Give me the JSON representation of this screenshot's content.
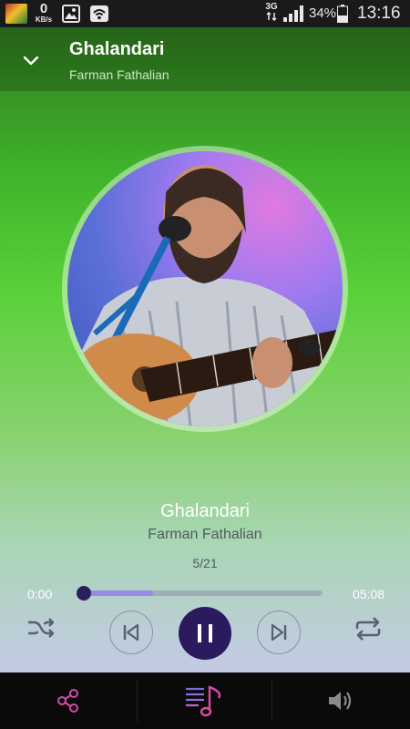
{
  "status_bar": {
    "net_speed_value": "0",
    "net_speed_unit": "KB/s",
    "network_type": "3G",
    "battery_percent": "34%",
    "time": "13:16",
    "icons": [
      "notification-thumbnail-icon",
      "gallery-icon",
      "wifi-icon",
      "signal-icon",
      "battery-icon"
    ]
  },
  "header": {
    "title": "Ghalandari",
    "artist": "Farman Fathalian",
    "collapse_icon": "chevron-down-icon"
  },
  "now_playing": {
    "title": "Ghalandari",
    "artist": "Farman Fathalian",
    "track_position": "5/21",
    "album_art": "artist-guitar-photo"
  },
  "progress": {
    "current_time": "0:00",
    "total_time": "05:08",
    "played_fraction": 0.0,
    "buffered_fraction": 0.29
  },
  "controls": {
    "shuffle_icon": "shuffle-icon",
    "previous_icon": "skip-previous-icon",
    "play_pause_icon": "pause-icon",
    "next_icon": "skip-next-icon",
    "repeat_icon": "repeat-icon"
  },
  "bottom_bar": {
    "share_icon": "share-icon",
    "playlist_icon": "playlist-music-icon",
    "volume_icon": "volume-icon"
  },
  "colors": {
    "accent": "#2a1a5e",
    "buffer": "#9a88e8",
    "share_pink": "#d44aa8"
  }
}
